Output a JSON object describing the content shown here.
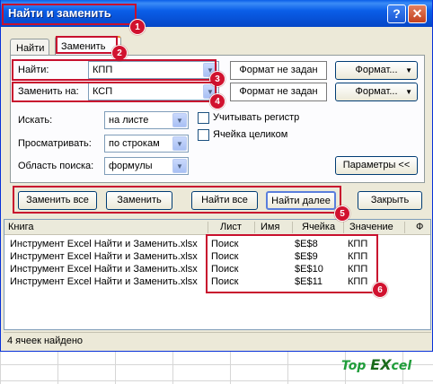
{
  "window": {
    "title": "Найти и заменить",
    "help": "?",
    "close": "✕"
  },
  "tabs": [
    {
      "label": "Найти"
    },
    {
      "label": "Заменить"
    }
  ],
  "find": {
    "label": "Найти:",
    "value": "КПП",
    "format_status": "Формат не задан",
    "format_button": "Формат..."
  },
  "replace": {
    "label": "Заменить на:",
    "value": "КСП",
    "format_status": "Формат не задан",
    "format_button": "Формат..."
  },
  "options": {
    "within_label": "Искать:",
    "within_value": "на листе",
    "search_label": "Просматривать:",
    "search_value": "по строкам",
    "lookin_label": "Область поиска:",
    "lookin_value": "формулы",
    "match_case": "Учитывать регистр",
    "match_entire": "Ячейка целиком",
    "params_button": "Параметры <<"
  },
  "actions": {
    "replace_all": "Заменить все",
    "replace": "Заменить",
    "find_all": "Найти все",
    "find_next": "Найти далее",
    "close": "Закрыть"
  },
  "results": {
    "columns": [
      "Книга",
      "Лист",
      "Имя",
      "Ячейка",
      "Значение",
      "Ф"
    ],
    "rows": [
      [
        "Инструмент Excel Найти и Заменить.xlsx",
        "Поиск",
        "",
        "$E$8",
        "КПП"
      ],
      [
        "Инструмент Excel Найти и Заменить.xlsx",
        "Поиск",
        "",
        "$E$9",
        "КПП"
      ],
      [
        "Инструмент Excel Найти и Заменить.xlsx",
        "Поиск",
        "",
        "$E$10",
        "КПП"
      ],
      [
        "Инструмент Excel Найти и Заменить.xlsx",
        "Поиск",
        "",
        "$E$11",
        "КПП"
      ]
    ],
    "status": "4 ячеек найдено"
  },
  "badges": [
    "1",
    "2",
    "3",
    "4",
    "5",
    "6"
  ],
  "logo": {
    "top": "Top",
    "ex": "EX",
    "cel": "cel"
  },
  "colors": {
    "annotation": "#c8102e",
    "titlebar": "#0a5ee8",
    "dialog": "#ece9d8"
  }
}
